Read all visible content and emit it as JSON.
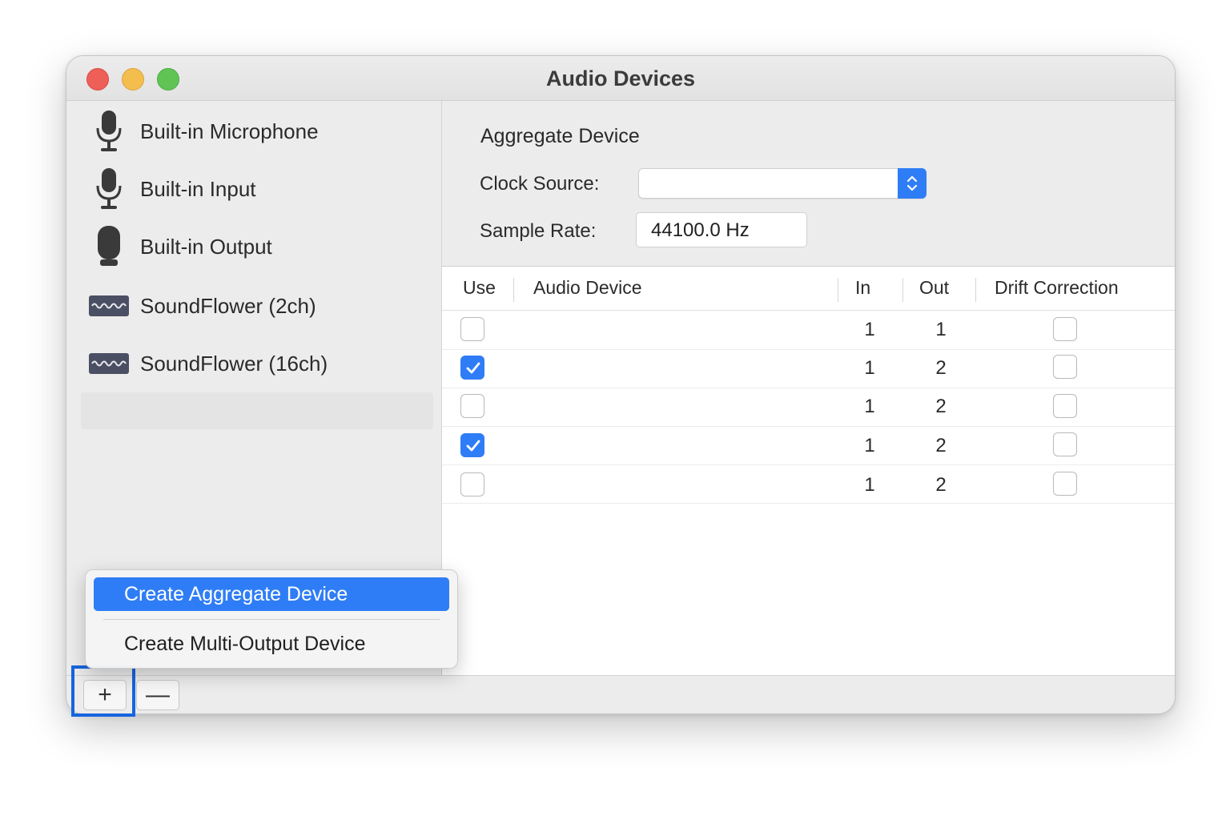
{
  "window": {
    "title": "Audio Devices"
  },
  "sidebar": {
    "items": [
      {
        "label": "Built-in Microphone",
        "icon": "microphone-icon"
      },
      {
        "label": "Built-in Input",
        "icon": "microphone-icon"
      },
      {
        "label": "Built-in Output",
        "icon": "speaker-icon"
      },
      {
        "label": "SoundFlower (2ch)",
        "icon": "soundflower-icon"
      },
      {
        "label": "SoundFlower (16ch)",
        "icon": "soundflower-icon"
      }
    ]
  },
  "detail": {
    "title": "Aggregate Device",
    "clock_label": "Clock Source:",
    "clock_value": "",
    "rate_label": "Sample Rate:",
    "rate_value": "44100.0 Hz"
  },
  "table": {
    "headers": {
      "use": "Use",
      "device": "Audio Device",
      "in": "In",
      "out": "Out",
      "drift": "Drift Correction"
    },
    "rows": [
      {
        "use": false,
        "device": "",
        "in": "1",
        "out": "1",
        "drift": false
      },
      {
        "use": true,
        "device": "",
        "in": "1",
        "out": "2",
        "drift": false
      },
      {
        "use": false,
        "device": "",
        "in": "1",
        "out": "2",
        "drift": false
      },
      {
        "use": true,
        "device": "",
        "in": "1",
        "out": "2",
        "drift": false
      },
      {
        "use": false,
        "device": "",
        "in": "1",
        "out": "2",
        "drift": false
      }
    ]
  },
  "menu": {
    "items": [
      {
        "label": "Create Aggregate Device",
        "active": true
      },
      {
        "label": "Create Multi-Output Device",
        "active": false
      }
    ]
  },
  "toolbar": {
    "add_label": "+",
    "remove_label": "—"
  },
  "colors": {
    "accent": "#2f7df6",
    "focus": "#1565e0"
  }
}
